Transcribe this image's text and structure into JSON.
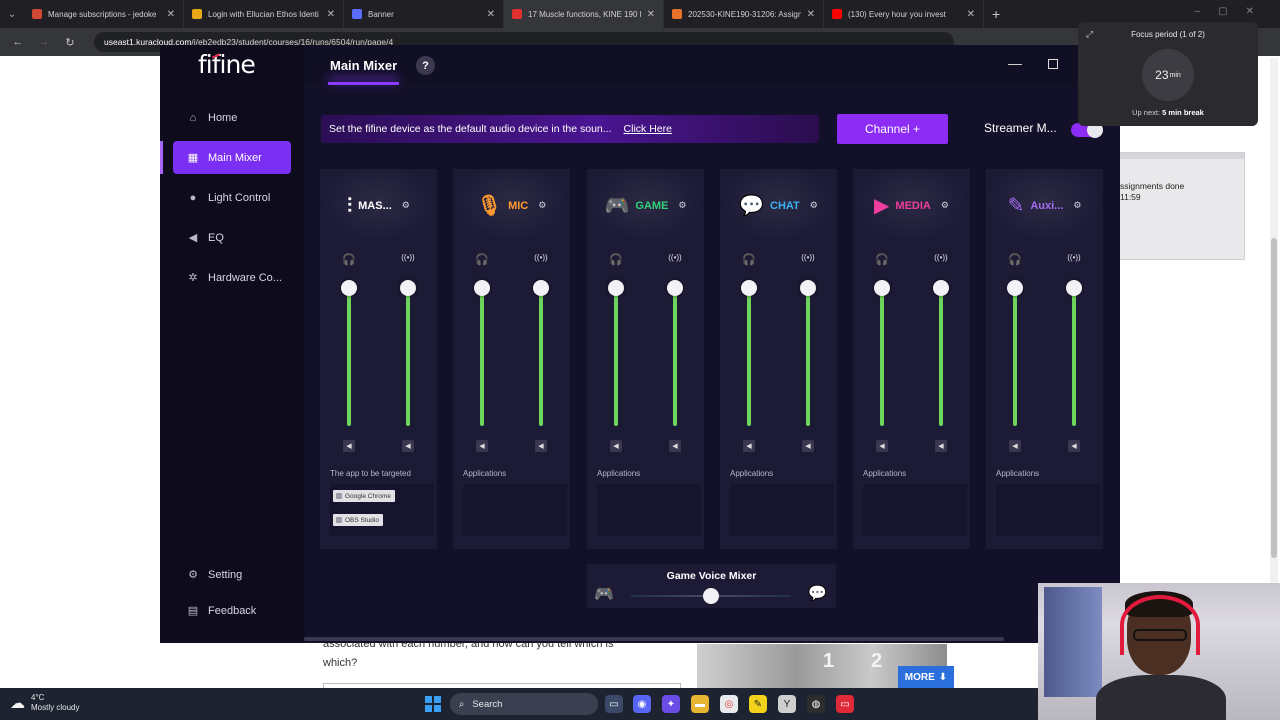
{
  "browser": {
    "tabs": [
      {
        "title": "Manage subscriptions - jedoke",
        "color": "#d14836",
        "active": false
      },
      {
        "title": "Login with Ellucian Ethos Identi",
        "color": "#e6a817",
        "active": false
      },
      {
        "title": "Banner",
        "color": "#5a6cff",
        "active": false
      },
      {
        "title": "17 Muscle functions, KINE 190 L",
        "color": "#e2302f",
        "active": true
      },
      {
        "title": "202530-KINE190-31206: Assign",
        "color": "#e8742a",
        "active": false
      },
      {
        "title": "(130) Every hour you invest",
        "color": "#ff0000",
        "active": false
      }
    ],
    "url_site": "useast1.kuracloud.com",
    "url_path": "/i/eb2edb23/student/courses/16/runs/6504/run/page/4"
  },
  "app": {
    "logo": "fifine",
    "top_tab": "Main Mixer",
    "help": "?",
    "sidebar": {
      "items": [
        {
          "label": "Home",
          "icon": "home-icon",
          "glyph": "⌂"
        },
        {
          "label": "Main Mixer",
          "icon": "mixer-icon",
          "glyph": "▦"
        },
        {
          "label": "Light Control",
          "icon": "bulb-icon",
          "glyph": "●"
        },
        {
          "label": "EQ",
          "icon": "speaker-icon",
          "glyph": "◀"
        },
        {
          "label": "Hardware Co...",
          "icon": "chip-icon",
          "glyph": "✲"
        }
      ],
      "bottom": [
        {
          "label": "Setting",
          "icon": "gear-icon",
          "glyph": "⚙"
        },
        {
          "label": "Feedback",
          "icon": "feedback-icon",
          "glyph": "▤"
        }
      ]
    },
    "banner_text": "Set the fifine device as the default audio device in the soun...",
    "banner_link": "Click Here",
    "channel_button": "Channel +",
    "streamer_label": "Streamer M...",
    "streamer_on": true,
    "channels": [
      {
        "name": "MAS...",
        "color": "#ffffff",
        "glyph": "⫶",
        "apps_label": "The app to be targeted",
        "apps": [
          "Google Chrome",
          "OBS Studio"
        ],
        "levels": [
          1.0,
          1.0
        ]
      },
      {
        "name": "MIC",
        "color": "#ff9b2f",
        "glyph": "🎙",
        "apps_label": "Applications",
        "apps": [],
        "levels": [
          1.0,
          1.0
        ]
      },
      {
        "name": "GAME",
        "color": "#33d07a",
        "glyph": "🎮",
        "apps_label": "Applications",
        "apps": [],
        "levels": [
          1.0,
          1.0
        ]
      },
      {
        "name": "CHAT",
        "color": "#3bb0f2",
        "glyph": "💬",
        "apps_label": "Applications",
        "apps": [],
        "levels": [
          1.0,
          1.0
        ]
      },
      {
        "name": "MEDIA",
        "color": "#f03e9e",
        "glyph": "▶",
        "apps_label": "Applications",
        "apps": [],
        "levels": [
          1.0,
          1.0
        ]
      },
      {
        "name": "Auxi...",
        "color": "#a56cf2",
        "glyph": "✎",
        "apps_label": "Applications",
        "apps": [],
        "levels": [
          1.0,
          1.0
        ]
      }
    ],
    "game_voice_mixer": {
      "title": "Game Voice Mixer",
      "balance": 0.5
    }
  },
  "focus": {
    "title": "Focus period (1 of 2)",
    "minutes": "23",
    "unit": "min",
    "next_prefix": "Up next: ",
    "next": "5 min break"
  },
  "tasks_card": {
    "line1": "ssignments done",
    "line2": "11:59"
  },
  "webpage": {
    "text": "associated with each number, and how can you tell which is which?",
    "img_n1": "1",
    "img_n2": "2",
    "more": "MORE"
  },
  "taskbar": {
    "temp": "4°C",
    "weather": "Mostly cloudy",
    "search": "Search"
  }
}
